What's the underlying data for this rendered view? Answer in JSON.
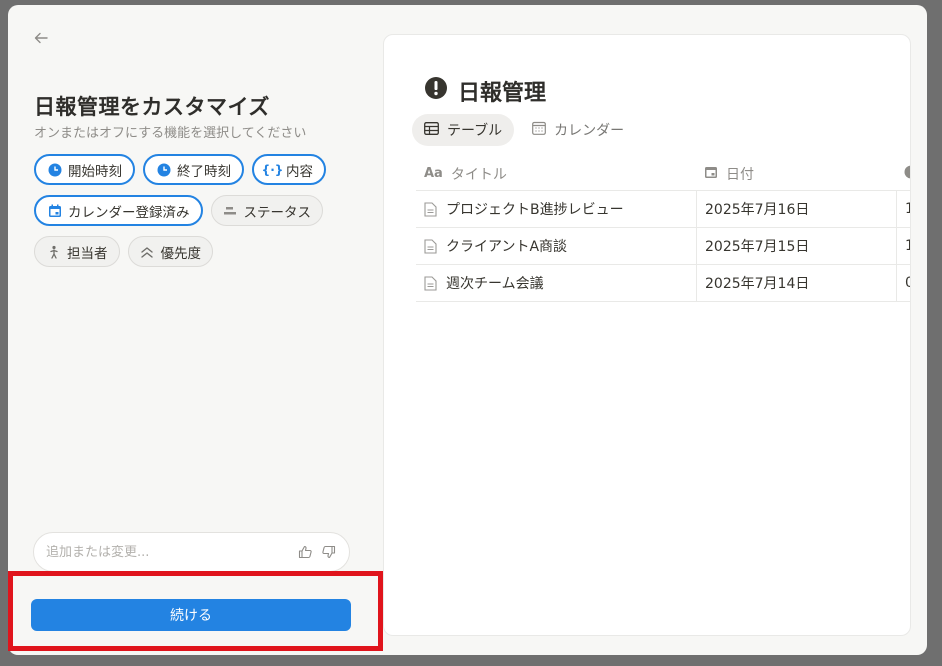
{
  "modal": {
    "heading": "日報管理をカスタマイズ",
    "subheading": "オンまたはオフにする機能を選択してください",
    "chips": [
      {
        "label": "開始時刻",
        "icon": "clock-icon",
        "on": true
      },
      {
        "label": "終了時刻",
        "icon": "clock-icon",
        "on": true
      },
      {
        "label": "内容",
        "icon": "braces-icon",
        "on": true
      },
      {
        "label": "カレンダー登録済み",
        "icon": "calendar-icon",
        "on": true
      },
      {
        "label": "ステータス",
        "icon": "status-icon",
        "on": false
      },
      {
        "label": "担当者",
        "icon": "person-icon",
        "on": false
      },
      {
        "label": "優先度",
        "icon": "chevrons-up-icon",
        "on": false
      }
    ],
    "input_placeholder": "追加または変更...",
    "continue_label": "続ける"
  },
  "preview": {
    "db_title": "日報管理",
    "views": [
      {
        "label": "テーブル",
        "icon": "table-icon",
        "active": true
      },
      {
        "label": "カレンダー",
        "icon": "calendar-view-icon",
        "active": false
      }
    ],
    "columns": [
      {
        "label": "タイトル",
        "icon": "text-type-icon"
      },
      {
        "label": "日付",
        "icon": "calendar-icon"
      },
      {
        "label": "",
        "icon": "clock-icon"
      }
    ],
    "rows": [
      {
        "title": "プロジェクトB進捗レビュー",
        "date": "2025年7月16日",
        "extra": "1"
      },
      {
        "title": "クライアントA商談",
        "date": "2025年7月15日",
        "extra": "1"
      },
      {
        "title": "週次チーム会議",
        "date": "2025年7月14日",
        "extra": "0"
      }
    ]
  },
  "colors": {
    "accent": "#2383e2",
    "highlight": "#e0141c"
  }
}
